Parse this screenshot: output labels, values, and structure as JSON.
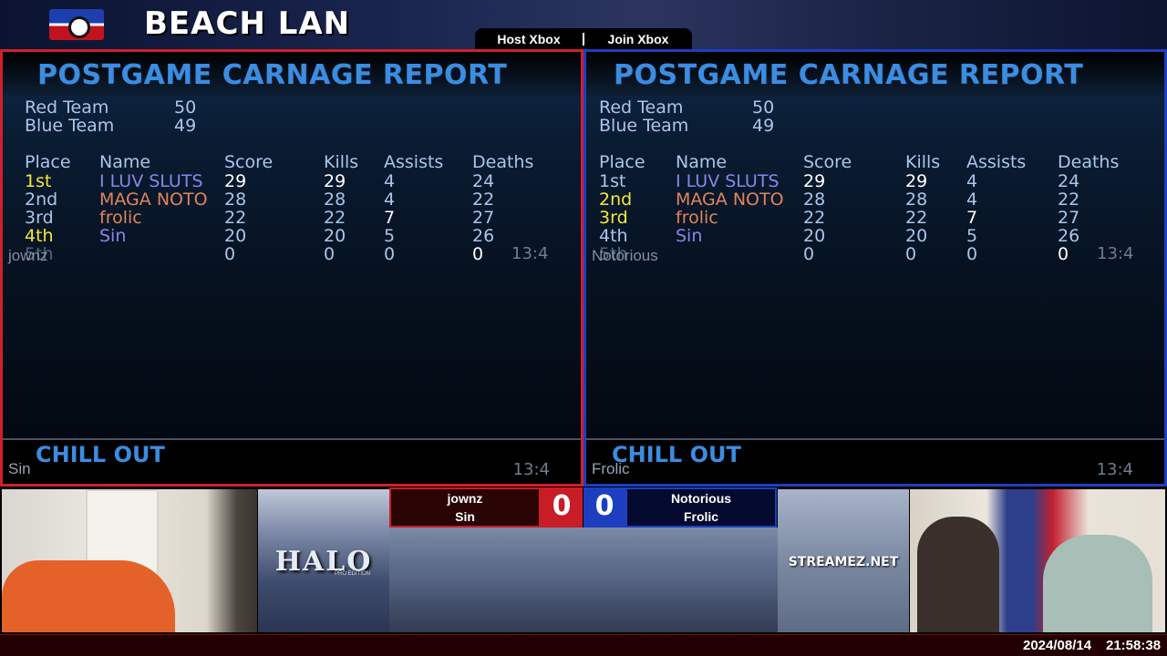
{
  "header": {
    "event_title": "BEACH LAN",
    "tabs": [
      "Host Xbox",
      "Join Xbox"
    ]
  },
  "screens": [
    {
      "title": "POSTGAME CARNAGE REPORT",
      "teams": [
        {
          "label": "Red Team",
          "score": "50"
        },
        {
          "label": "Blue Team",
          "score": "49"
        }
      ],
      "columns": [
        "Place",
        "Name",
        "Score",
        "Kills",
        "Assists",
        "Deaths"
      ],
      "rows": [
        {
          "place": "1st",
          "name": "I LUV SLUTS",
          "score": "29",
          "kills": "29",
          "assists": "4",
          "deaths": "24"
        },
        {
          "place": "2nd",
          "name": "MAGA NOTO",
          "score": "28",
          "kills": "28",
          "assists": "4",
          "deaths": "22"
        },
        {
          "place": "3rd",
          "name": "frolic",
          "score": "22",
          "kills": "22",
          "assists": "7",
          "deaths": "27"
        },
        {
          "place": "4th",
          "name": "Sin",
          "score": "20",
          "kills": "20",
          "assists": "5",
          "deaths": "26"
        },
        {
          "place": "5th",
          "name": "",
          "score": "0",
          "kills": "0",
          "assists": "0",
          "deaths": "0"
        }
      ],
      "overlay_player": "jownz",
      "clock": "13:4",
      "bottom_title": "CHILL OUT",
      "bottom_player": "Sin",
      "bottom_clock": "13:4"
    },
    {
      "title": "POSTGAME CARNAGE REPORT",
      "teams": [
        {
          "label": "Red Team",
          "score": "50"
        },
        {
          "label": "Blue Team",
          "score": "49"
        }
      ],
      "columns": [
        "Place",
        "Name",
        "Score",
        "Kills",
        "Assists",
        "Deaths"
      ],
      "rows": [
        {
          "place": "1st",
          "name": "I LUV SLUTS",
          "score": "29",
          "kills": "29",
          "assists": "4",
          "deaths": "24"
        },
        {
          "place": "2nd",
          "name": "MAGA NOTO",
          "score": "28",
          "kills": "28",
          "assists": "4",
          "deaths": "22"
        },
        {
          "place": "3rd",
          "name": "frolic",
          "score": "22",
          "kills": "22",
          "assists": "7",
          "deaths": "27"
        },
        {
          "place": "4th",
          "name": "Sin",
          "score": "20",
          "kills": "20",
          "assists": "5",
          "deaths": "26"
        },
        {
          "place": "5th",
          "name": "",
          "score": "0",
          "kills": "0",
          "assists": "0",
          "deaths": "0"
        }
      ],
      "overlay_player": "Notorious",
      "clock": "13:4",
      "bottom_title": "CHILL OUT",
      "bottom_player": "Frolic",
      "bottom_clock": "13:4"
    }
  ],
  "scoreboard": {
    "red_players": [
      "jownz",
      "Sin"
    ],
    "red_score": "0",
    "blue_score": "0",
    "blue_players": [
      "Notorious",
      "Frolic"
    ]
  },
  "tiles": {
    "halo_logo": "HALO",
    "halo_sub": "PRO EDITION",
    "stream": "STREAMEZ.NET"
  },
  "footer": {
    "date": "2024/08/14",
    "time": "21:58:38"
  },
  "colors": {
    "red_accent": "#c81d27",
    "blue_accent": "#1d3fbf",
    "pcr_title": "#3c8ce0"
  }
}
